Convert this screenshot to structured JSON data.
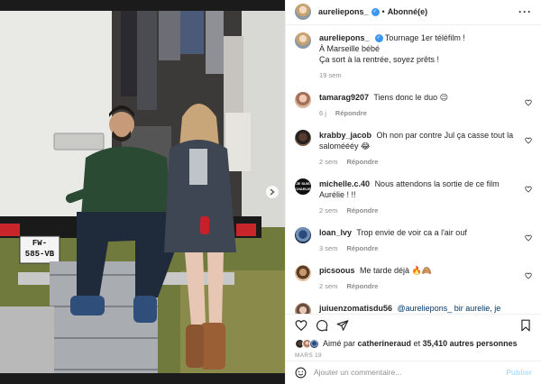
{
  "author": {
    "username": "aureliepons_",
    "follow_status": "Abonné(e)"
  },
  "caption": {
    "username": "aureliepons_",
    "lines": [
      "Tournage 1er téléfilm !",
      "À Marseille bébé",
      "Ça sort à la rentrée, soyez prêts !"
    ],
    "age": "19 sem"
  },
  "comments": [
    {
      "username": "tamarag9207",
      "text": "Tiens donc le duo 😉",
      "age": "6 j",
      "reply": "Répondre"
    },
    {
      "username": "krabby_jacob",
      "text": "Oh non par contre Jul ça casse tout la saloméééy 😂",
      "age": "2 sem",
      "reply": "Répondre"
    },
    {
      "username": "michelle.c.40",
      "text": "Nous attendons la sortie de ce film Aurélie ! !!",
      "age": "2 sem",
      "reply": "Répondre",
      "avatar_text": "JE SUIS CHARLIE"
    },
    {
      "username": "loan_lvy",
      "text": "Trop envie de voir ca a l'air ouf",
      "age": "3 sem",
      "reply": "Répondre"
    },
    {
      "username": "picsoous",
      "text": "Me tarde déjà 🔥🙈",
      "age": "2 sem",
      "reply": "Répondre"
    },
    {
      "username": "juiuenzomatisdu56",
      "text": "@aureliepons_ bir aurelie, je voulais",
      "age": "",
      "reply": ""
    }
  ],
  "likes": {
    "prefix": "Aimé par",
    "user": "catherineraud",
    "connector": "et",
    "count_text": "35,410 autres personnes"
  },
  "date": "MARS 19",
  "composer": {
    "placeholder": "Ajouter un commentaire...",
    "publish_label": "Publier"
  },
  "photo": {
    "plate_line1": "FW-",
    "plate_line2": "585-VB"
  },
  "icons": {
    "more": "more-options-icon",
    "verified": "verified-badge-icon",
    "like": "heart-icon",
    "comment": "comment-icon",
    "share": "share-icon",
    "save": "bookmark-icon",
    "emoji": "emoji-icon",
    "carousel": "chevron-right-icon"
  },
  "colors": {
    "accent": "#3897f0",
    "publish_disabled": "#b2dffc",
    "meta": "#8e8e8e"
  }
}
